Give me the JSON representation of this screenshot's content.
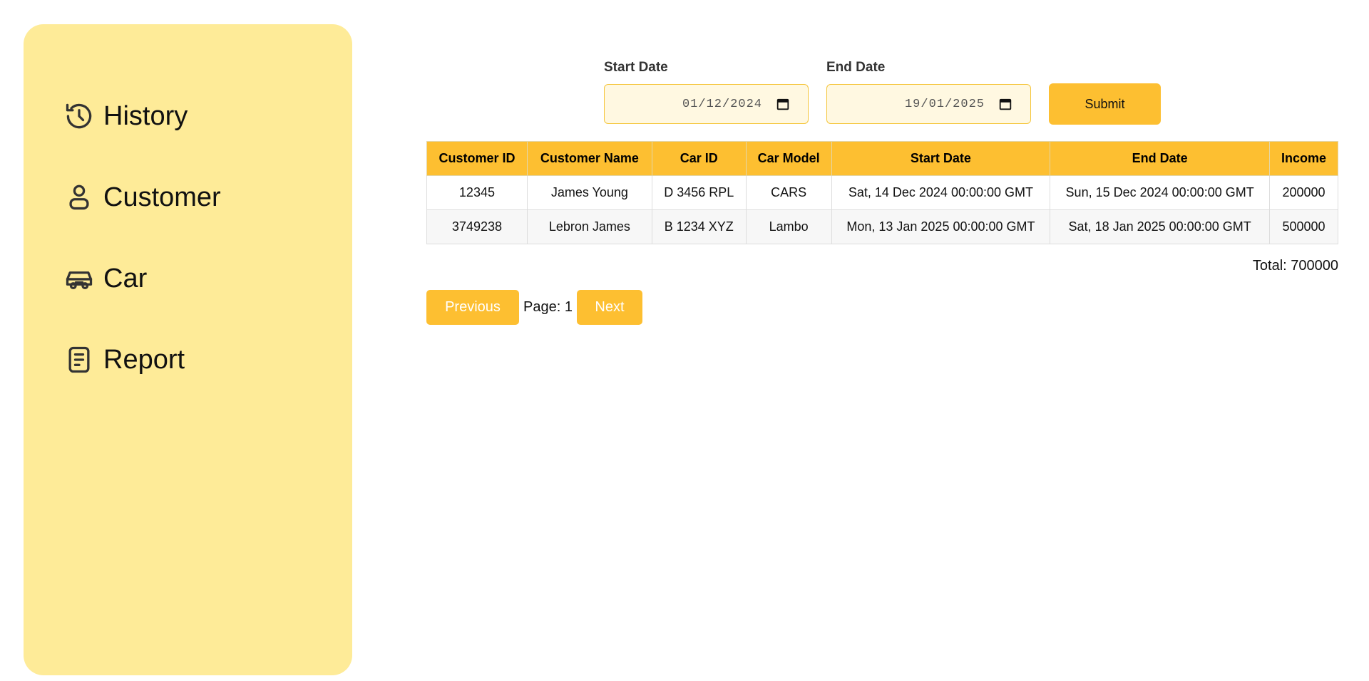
{
  "sidebar": {
    "items": [
      {
        "label": "History",
        "icon": "history-icon"
      },
      {
        "label": "Customer",
        "icon": "user-icon"
      },
      {
        "label": "Car",
        "icon": "car-icon"
      },
      {
        "label": "Report",
        "icon": "report-icon"
      }
    ]
  },
  "filters": {
    "start_label": "Start Date",
    "start_value": "01/12/2024",
    "end_label": "End Date",
    "end_value": "19/01/2025",
    "submit_label": "Submit"
  },
  "table": {
    "headers": [
      "Customer ID",
      "Customer Name",
      "Car ID",
      "Car Model",
      "Start Date",
      "End Date",
      "Income"
    ],
    "rows": [
      [
        "12345",
        "James Young",
        "D 3456 RPL",
        "CARS",
        "Sat, 14 Dec 2024 00:00:00 GMT",
        "Sun, 15 Dec 2024 00:00:00 GMT",
        "200000"
      ],
      [
        "3749238",
        "Lebron James",
        "B 1234 XYZ",
        "Lambo",
        "Mon, 13 Jan 2025 00:00:00 GMT",
        "Sat, 18 Jan 2025 00:00:00 GMT",
        "500000"
      ]
    ]
  },
  "total": "Total: 700000",
  "pagination": {
    "previous_label": "Previous",
    "page_text": "Page: 1",
    "next_label": "Next"
  },
  "colors": {
    "sidebar_bg": "#feeb98",
    "accent": "#fdbf31",
    "input_bg": "#fff8e1"
  }
}
